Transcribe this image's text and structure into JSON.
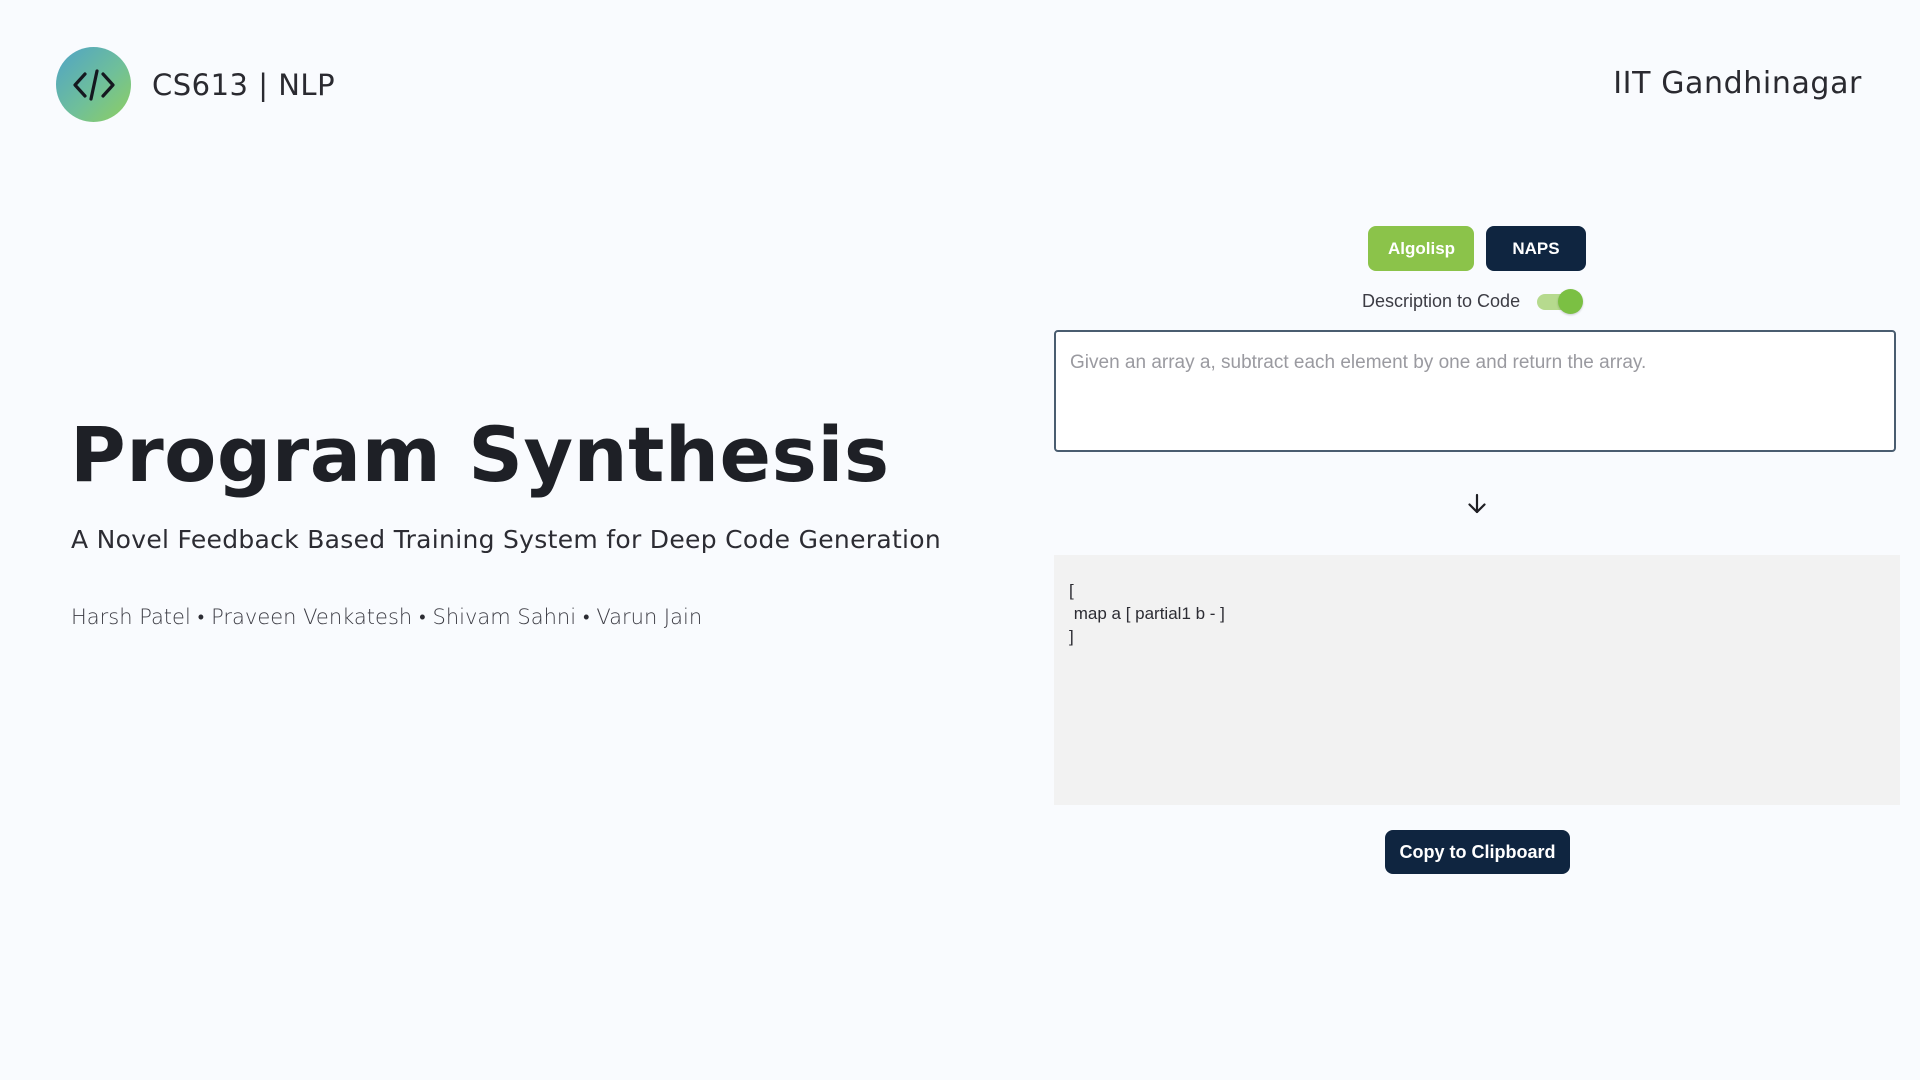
{
  "header": {
    "logo_icon": "code-brackets-icon",
    "brand_title": "CS613 | NLP",
    "institute": "IIT Gandhinagar"
  },
  "hero": {
    "title": "Program Synthesis",
    "subtitle": "A Novel Feedback Based Training System for Deep Code Generation",
    "authors": [
      "Harsh Patel",
      "Praveen Venkatesh",
      "Shivam Sahni",
      "Varun Jain"
    ],
    "separator": "•"
  },
  "panel": {
    "datasets": [
      {
        "label": "Algolisp",
        "selected": true
      },
      {
        "label": "NAPS",
        "selected": false
      }
    ],
    "mode_label": "Description to Code",
    "mode_toggle_on": true,
    "input_placeholder": "Given an array a, subtract each element by one and return the array.",
    "input_value": "",
    "arrow_icon": "arrow-down-icon",
    "output_text": "[\n map a [ partial1 b - ]\n]",
    "copy_label": "Copy to Clipboard"
  },
  "colors": {
    "background": "#f9fbfe",
    "accent_green": "#8bc34a",
    "navy": "#0f2540",
    "output_bg": "#f2f2f2"
  }
}
